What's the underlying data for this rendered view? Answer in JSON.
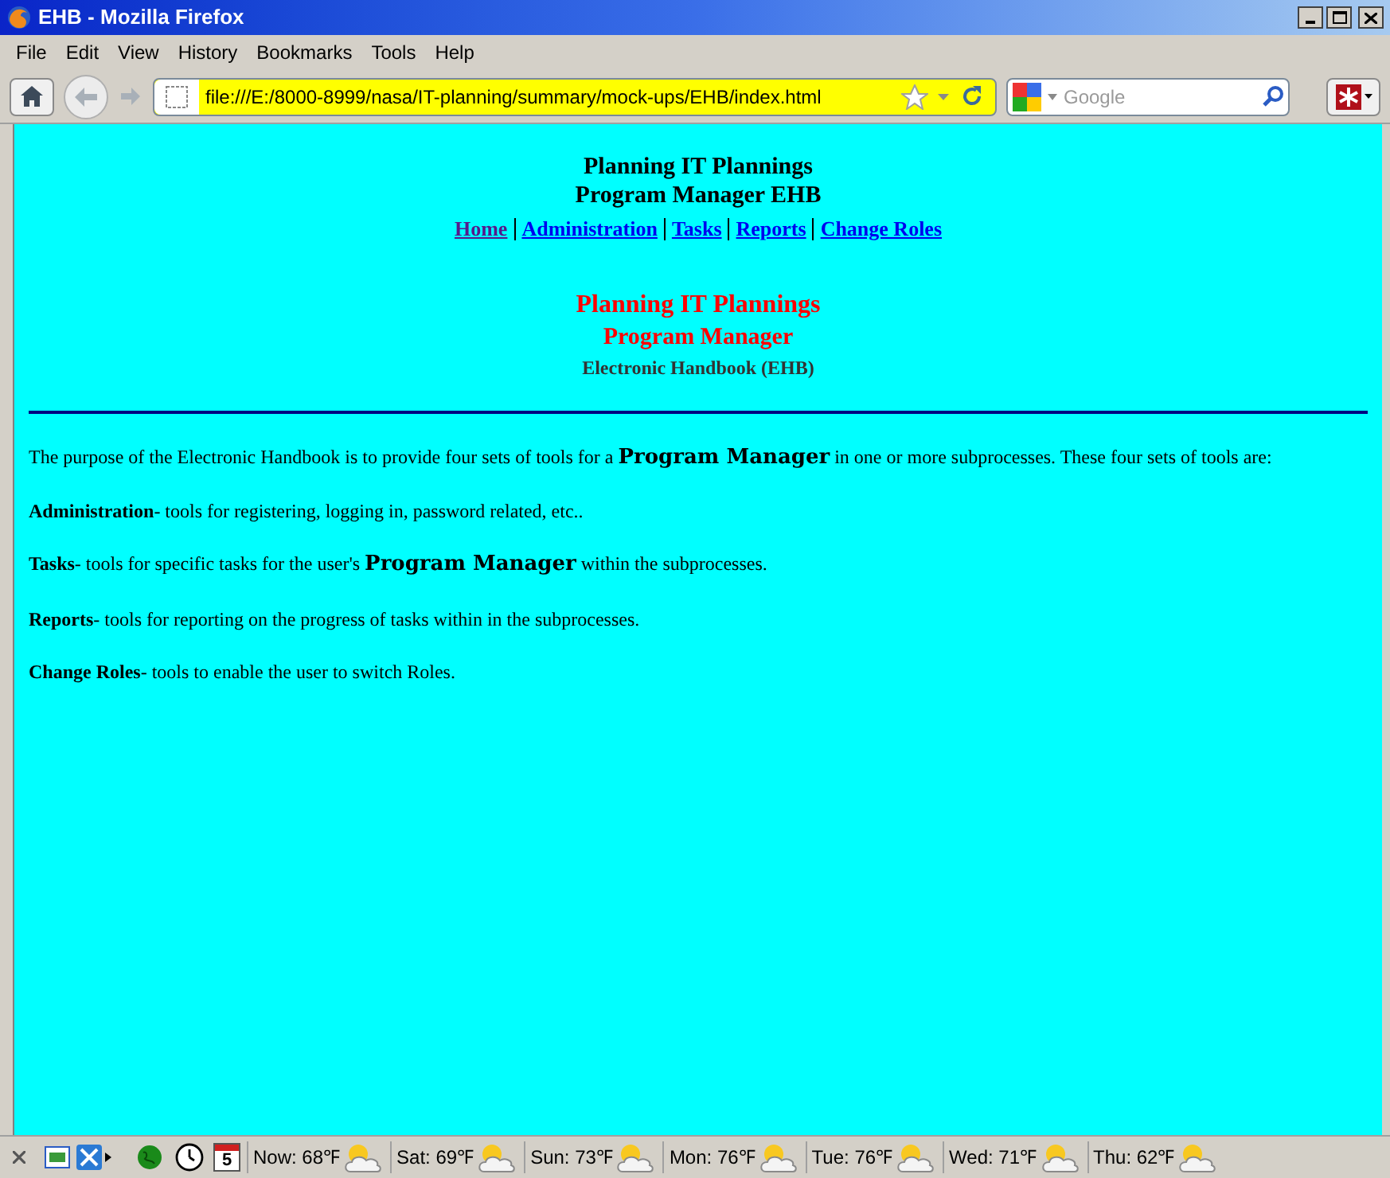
{
  "window": {
    "title": "EHB - Mozilla Firefox"
  },
  "menu": [
    "File",
    "Edit",
    "View",
    "History",
    "Bookmarks",
    "Tools",
    "Help"
  ],
  "url": "file:///E:/8000-8999/nasa/IT-planning/summary/mock-ups/EHB/index.html",
  "search": {
    "placeholder": "Google"
  },
  "page": {
    "heading": [
      "Planning IT Plannings",
      "Program Manager EHB"
    ],
    "nav": [
      {
        "label": "Home",
        "visited": true
      },
      {
        "label": "Administration",
        "visited": false
      },
      {
        "label": "Tasks",
        "visited": false
      },
      {
        "label": "Reports",
        "visited": false
      },
      {
        "label": "Change Roles",
        "visited": false
      }
    ],
    "title": [
      "Planning IT Plannings",
      "Program Manager"
    ],
    "subtitle": "Electronic Handbook (EHB)",
    "paragraphs": [
      "The purpose of the Electronic Handbook is to provide four sets of tools for a **Program Manager** in one or more subprocesses. These four sets of tools are:",
      "**Administration**- tools for registering, logging in, password related, etc..",
      "**Tasks**- tools for specific tasks for the user's **Program Manager** within the subprocesses.",
      "**Reports**- tools for reporting on the progress of tasks within in the subprocesses.",
      "**Change Roles**- tools to enable the user to switch Roles."
    ]
  },
  "status_bar": {
    "calendar_day": "5",
    "weather": [
      "Now: 68℉",
      "Sat: 69℉",
      "Sun: 73℉",
      "Mon: 76℉",
      "Tue: 76℉",
      "Wed: 71℉",
      "Thu: 62℉"
    ]
  }
}
